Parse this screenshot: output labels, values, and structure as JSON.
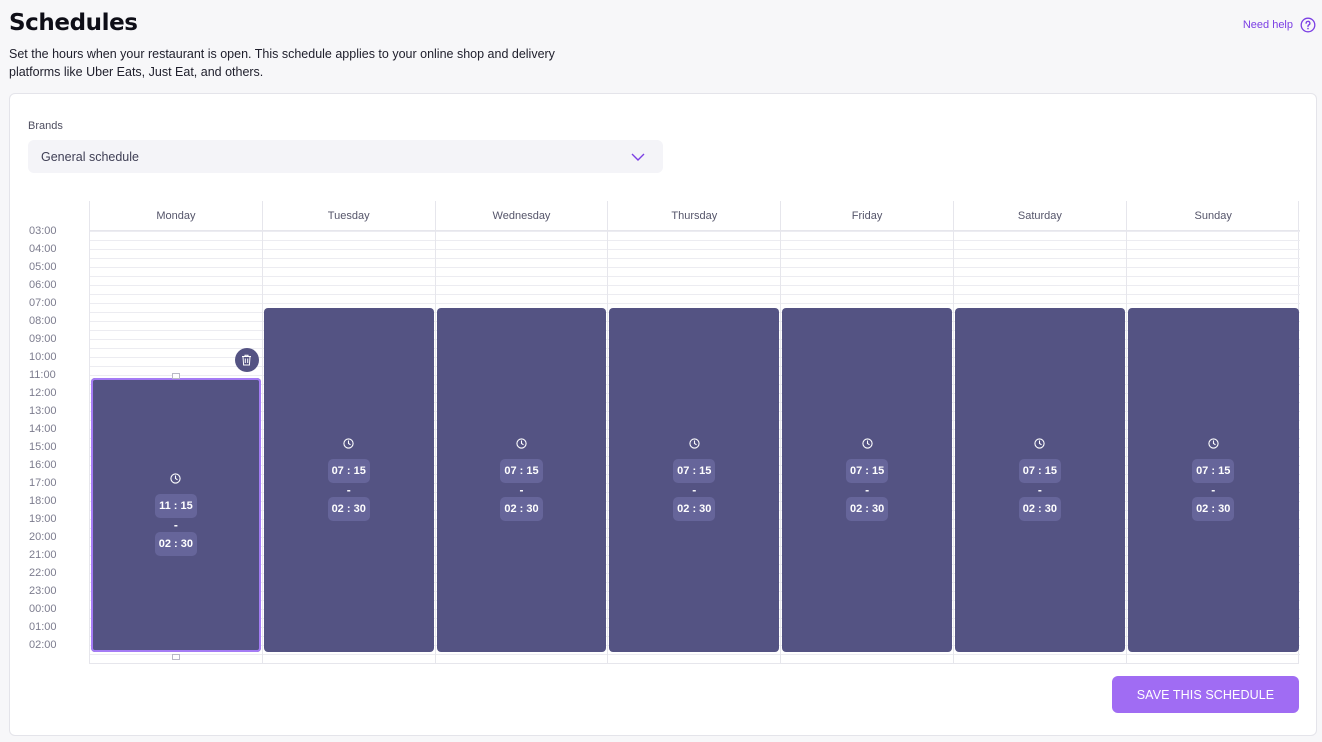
{
  "page": {
    "title": "Schedules",
    "description": "Set the hours when your restaurant is open. This schedule applies to your online shop and delivery platforms like Uber Eats, Just Eat, and others.",
    "help_label": "Need help",
    "help_icon": "question-circle-icon"
  },
  "brands": {
    "label": "Brands",
    "selected": "General schedule",
    "icon": "chevron-down-icon"
  },
  "hours": [
    "03:00",
    "04:00",
    "05:00",
    "06:00",
    "07:00",
    "08:00",
    "09:00",
    "10:00",
    "11:00",
    "12:00",
    "13:00",
    "14:00",
    "15:00",
    "16:00",
    "17:00",
    "18:00",
    "19:00",
    "20:00",
    "21:00",
    "22:00",
    "23:00",
    "00:00",
    "01:00",
    "02:00"
  ],
  "days": [
    {
      "name": "Monday",
      "slots": [
        {
          "from": "11 : 15",
          "to": "02 : 30",
          "selected": true
        }
      ]
    },
    {
      "name": "Tuesday",
      "slots": [
        {
          "from": "07 : 15",
          "to": "02 : 30",
          "selected": false
        }
      ]
    },
    {
      "name": "Wednesday",
      "slots": [
        {
          "from": "07 : 15",
          "to": "02 : 30",
          "selected": false
        }
      ]
    },
    {
      "name": "Thursday",
      "slots": [
        {
          "from": "07 : 15",
          "to": "02 : 30",
          "selected": false
        }
      ]
    },
    {
      "name": "Friday",
      "slots": [
        {
          "from": "07 : 15",
          "to": "02 : 30",
          "selected": false
        }
      ]
    },
    {
      "name": "Saturday",
      "slots": [
        {
          "from": "07 : 15",
          "to": "02 : 30",
          "selected": false
        }
      ]
    },
    {
      "name": "Sunday",
      "slots": [
        {
          "from": "07 : 15",
          "to": "02 : 30",
          "selected": false
        }
      ]
    }
  ],
  "slot_separator": "-",
  "save_label": "SAVE THIS SCHEDULE",
  "colors": {
    "accent": "#a06cf3",
    "block": "#545383",
    "chip": "#66659a",
    "selected_outline": "#a57cf5"
  }
}
